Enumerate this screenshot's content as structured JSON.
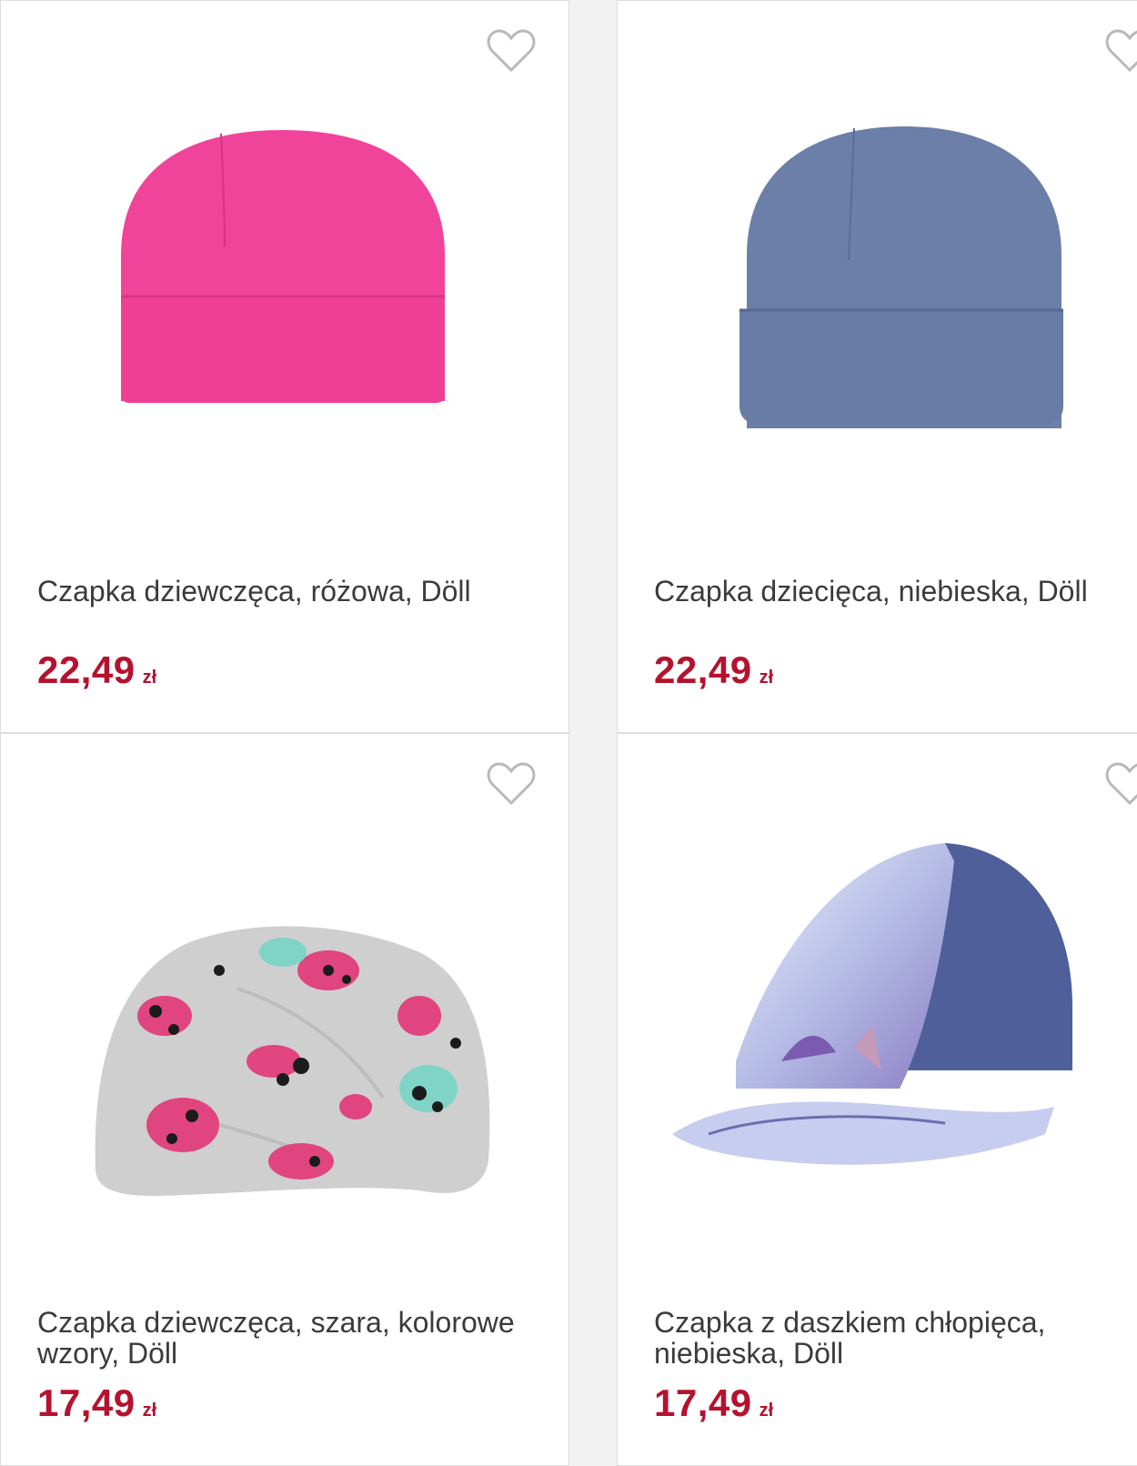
{
  "products": [
    {
      "title": "Czapka dziewczęca, różowa, Döll",
      "price": "22,49",
      "currency": "zł",
      "icon": "heart-outline-icon"
    },
    {
      "title": "Czapka dziecięca, niebieska, Döll",
      "price": "22,49",
      "currency": "zł",
      "icon": "heart-outline-icon"
    },
    {
      "title": "Czapka dziewczęca, szara, kolorowe wzory, Döll",
      "price": "17,49",
      "currency": "zł",
      "icon": "heart-outline-icon"
    },
    {
      "title": "Czapka z daszkiem chłopięca, niebieska, Döll",
      "price": "17,49",
      "currency": "zł",
      "icon": "heart-outline-icon"
    }
  ],
  "colors": {
    "price": "#b5122e",
    "title": "#3b3b3b",
    "heart": "#b9b9b9",
    "hat_pink": "#f0449a",
    "hat_blue": "#6b7fa8",
    "hat_grey": "#cfcfcf",
    "cap_crown": "#4e5f9a"
  }
}
